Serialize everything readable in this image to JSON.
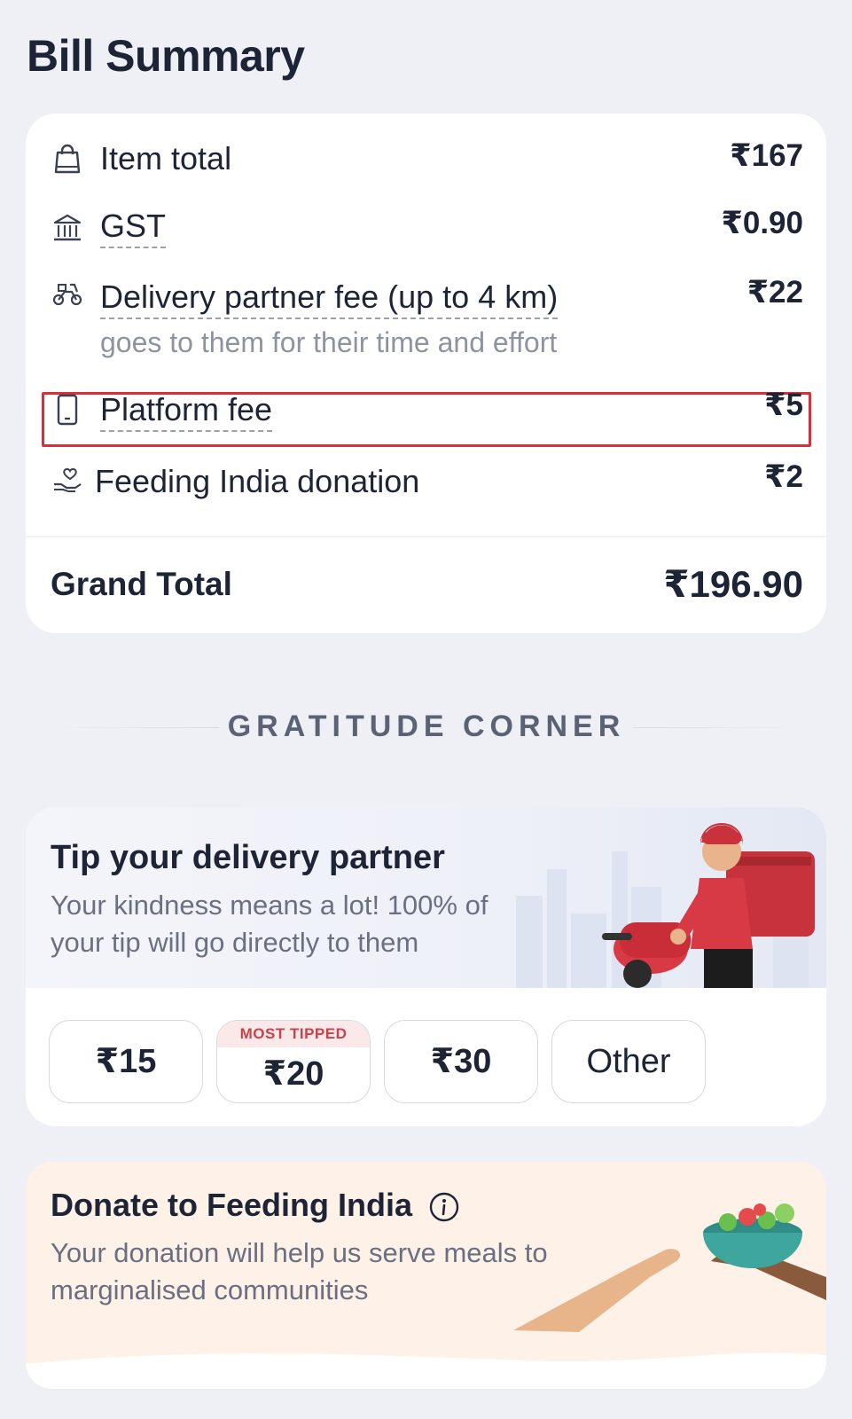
{
  "page_title": "Bill Summary",
  "bill": {
    "item_total": {
      "label": "Item total",
      "value": "₹167",
      "icon": "shopping-bag-icon"
    },
    "gst": {
      "label": "GST",
      "value": "₹0.90",
      "icon": "bank-icon"
    },
    "delivery": {
      "label": "Delivery partner fee (up to 4 km)",
      "sub": "goes to them for their time and effort",
      "value": "₹22",
      "icon": "scooter-icon"
    },
    "platform": {
      "label": "Platform fee",
      "value": "₹5",
      "icon": "phone-icon"
    },
    "donation": {
      "label": "Feeding India donation",
      "value": "₹2",
      "icon": "hand-heart-icon"
    },
    "grand_total": {
      "label": "Grand Total",
      "value": "₹196.90"
    }
  },
  "gratitude_heading": "GRATITUDE CORNER",
  "tip": {
    "title": "Tip your delivery partner",
    "subtitle": "Your kindness means a lot! 100% of your tip will go directly to them",
    "options": [
      {
        "amount": "₹15"
      },
      {
        "amount": "₹20",
        "badge": "MOST TIPPED"
      },
      {
        "amount": "₹30"
      },
      {
        "amount": "Other"
      }
    ]
  },
  "donate": {
    "title": "Donate to Feeding India",
    "subtitle": "Your donation will help us serve meals to marginalised communities"
  },
  "colors": {
    "accent_red": "#d72f3b",
    "badge_bg": "#fbe9ea",
    "donate_bg": "#fdf1e8",
    "page_bg": "#eef0f6"
  }
}
